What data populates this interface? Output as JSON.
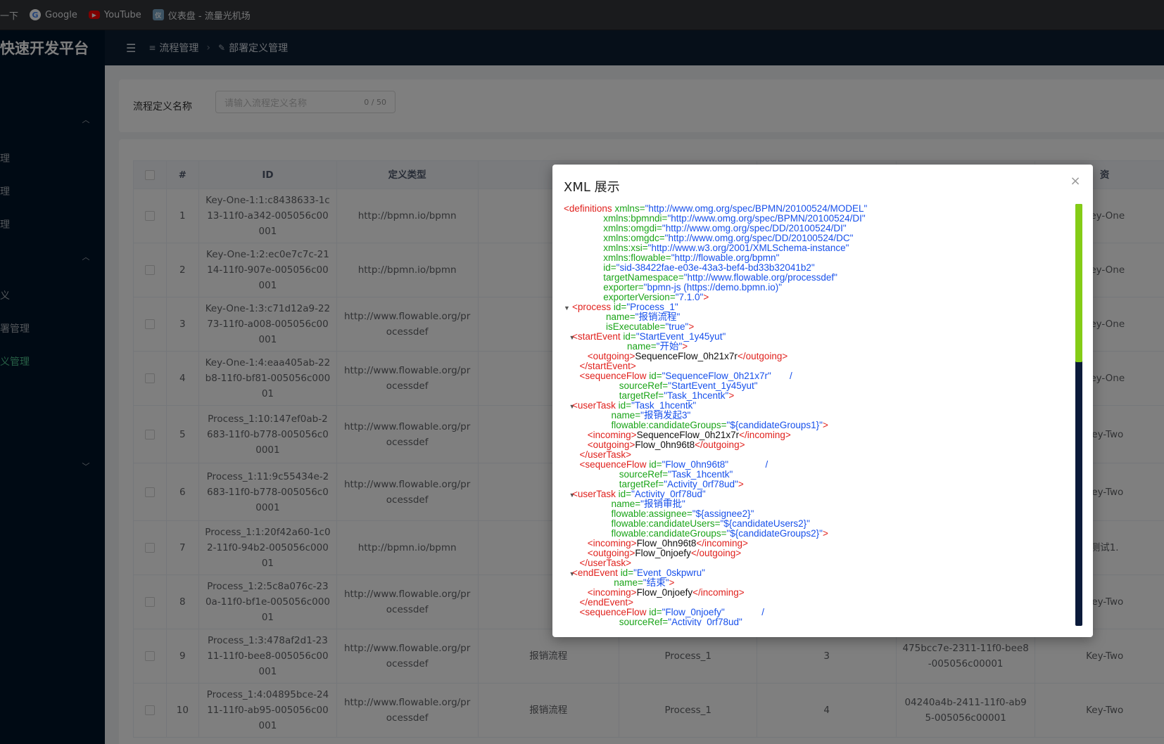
{
  "bookmarks": [
    {
      "icon": "",
      "label": "一下"
    },
    {
      "icon": "G",
      "label": "Google"
    },
    {
      "icon": "▶",
      "label": "YouTube"
    },
    {
      "icon": "仪",
      "label": "仪表盘 - 流量光机场"
    }
  ],
  "sidebar": {
    "logo": "快速开发平台",
    "items": [
      {
        "label": "理",
        "active": false
      },
      {
        "label": "理",
        "active": false
      },
      {
        "label": "理",
        "active": false
      },
      {
        "label": "义",
        "active": false
      },
      {
        "label": "署管理",
        "active": false
      },
      {
        "label": "义管理",
        "active": true
      }
    ]
  },
  "header": {
    "menu_icon": "☰",
    "breadcrumb": [
      {
        "icon": "≡",
        "label": "流程管理"
      },
      {
        "icon": "✎",
        "label": "部署定义管理"
      }
    ]
  },
  "search": {
    "label": "流程定义名称",
    "placeholder": "请输入流程定义名称",
    "count": "0 / 50"
  },
  "table": {
    "columns": [
      "#",
      "ID",
      "定义类型",
      "",
      "",
      "",
      "",
      "资"
    ],
    "rows": [
      {
        "num": "1",
        "id": "Key-One-1:1:c8438633-1c13-11f0-a342-005056c00001",
        "type": "http://bpmn.io/bpmn",
        "name": "",
        "key": "",
        "version": "",
        "deploy": "",
        "res": "Key-One"
      },
      {
        "num": "2",
        "id": "Key-One-1:2:ec0e7c7c-2114-11f0-907e-005056c00001",
        "type": "http://bpmn.io/bpmn",
        "name": "",
        "key": "",
        "version": "",
        "deploy": "",
        "res": "Key-One"
      },
      {
        "num": "3",
        "id": "Key-One-1:3:c71d12a9-2273-11f0-a008-005056c00001",
        "type": "http://www.flowable.org/processdef",
        "name": "",
        "key": "",
        "version": "",
        "deploy": "",
        "res": "Key-One"
      },
      {
        "num": "4",
        "id": "Key-One-1:4:eaa405ab-22b8-11f0-bf81-005056c00001",
        "type": "http://www.flowable.org/processdef",
        "name": "",
        "key": "",
        "version": "",
        "deploy": "",
        "res": "Key-One"
      },
      {
        "num": "5",
        "id": "Process_1:10:147ef0ab-2683-11f0-b778-005056c00001",
        "type": "http://www.flowable.org/processdef",
        "name": "",
        "key": "",
        "version": "",
        "deploy": "",
        "res": "Key-Two"
      },
      {
        "num": "6",
        "id": "Process_1:11:9c55434e-2683-11f0-b778-005056c00001",
        "type": "http://www.flowable.org/processdef",
        "name": "",
        "key": "",
        "version": "",
        "deploy": "",
        "res": "Key-Two"
      },
      {
        "num": "7",
        "id": "Process_1:1:20f42a60-1c02-11f0-94b2-005056c00001",
        "type": "http://bpmn.io/bpmn",
        "name": "",
        "key": "",
        "version": "",
        "deploy": "",
        "res": "测试1."
      },
      {
        "num": "8",
        "id": "Process_1:2:5c8a076c-230a-11f0-bf1e-005056c00001",
        "type": "http://www.flowable.org/processdef",
        "name": "",
        "key": "",
        "version": "",
        "deploy": "",
        "res": "Key-Two"
      },
      {
        "num": "9",
        "id": "Process_1:3:478af2d1-2311-11f0-bee8-005056c00001",
        "type": "http://www.flowable.org/processdef",
        "name": "报销流程",
        "key": "Process_1",
        "version": "3",
        "deploy": "475bcc7e-2311-11f0-bee8-005056c00001",
        "res": "Key-Two"
      },
      {
        "num": "10",
        "id": "Process_1:4:04895bce-2411-11f0-ab95-005056c00001",
        "type": "http://www.flowable.org/processdef",
        "name": "报销流程",
        "key": "Process_1",
        "version": "4",
        "deploy": "04240a4b-2411-11f0-ab95-005056c00001",
        "res": "Key-Two"
      }
    ]
  },
  "modal": {
    "title": "XML 展示",
    "close_icon": "×",
    "xml_lines": [
      [
        [
          "tg",
          "<definitions "
        ],
        [
          "at",
          "xmlns="
        ],
        [
          "vl",
          "\"http://www.omg.org/spec/BPMN/20100524/MODEL\""
        ]
      ],
      [
        [
          "at",
          "               xmlns:bpmndi="
        ],
        [
          "vl",
          "\"http://www.omg.org/spec/BPMN/20100524/DI\""
        ]
      ],
      [
        [
          "at",
          "               xmlns:omgdi="
        ],
        [
          "vl",
          "\"http://www.omg.org/spec/DD/20100524/DI\""
        ]
      ],
      [
        [
          "at",
          "               xmlns:omgdc="
        ],
        [
          "vl",
          "\"http://www.omg.org/spec/DD/20100524/DC\""
        ]
      ],
      [
        [
          "at",
          "               xmlns:xsi="
        ],
        [
          "vl",
          "\"http://www.w3.org/2001/XMLSchema-instance\""
        ]
      ],
      [
        [
          "at",
          "               xmlns:flowable="
        ],
        [
          "vl",
          "\"http://flowable.org/bpmn\""
        ]
      ],
      [
        [
          "at",
          "               id="
        ],
        [
          "vl",
          "\"sid-38422fae-e03e-43a3-bef4-bd33b32041b2\""
        ]
      ],
      [
        [
          "at",
          "               targetNamespace="
        ],
        [
          "vl",
          "\"http://www.flowable.org/processdef\""
        ]
      ],
      [
        [
          "at",
          "               exporter="
        ],
        [
          "vl",
          "\"bpmn-js (https://demo.bpmn.io)\""
        ]
      ],
      [
        [
          "at",
          "               exporterVersion="
        ],
        [
          "vl",
          "\"7.1.0\""
        ],
        [
          "tg",
          ">"
        ]
      ],
      [
        [
          "tog",
          "▼"
        ],
        [
          "tg",
          "<process "
        ],
        [
          "at",
          "id="
        ],
        [
          "vl",
          "\"Process_1\""
        ]
      ],
      [
        [
          "at",
          "                name="
        ],
        [
          "vl",
          "\"报销流程\""
        ]
      ],
      [
        [
          "at",
          "                isExecutable="
        ],
        [
          "vl",
          "\"true\""
        ],
        [
          "tg",
          ">"
        ]
      ],
      [
        [
          "tog",
          "   ▼"
        ],
        [
          "tg",
          "<startEvent "
        ],
        [
          "at",
          "id="
        ],
        [
          "vl",
          "\"StartEvent_1y45yut\""
        ]
      ],
      [
        [
          "at",
          "                        name="
        ],
        [
          "vl",
          "\"开始\""
        ],
        [
          "tg",
          ">"
        ]
      ],
      [
        [
          "tg",
          "         <outgoing>"
        ],
        [
          "tx",
          "SequenceFlow_0h21x7r"
        ],
        [
          "tg",
          "</outgoing>"
        ]
      ],
      [
        [
          "tg",
          "      </startEvent>"
        ]
      ],
      [
        [
          "tg",
          "      <sequenceFlow "
        ],
        [
          "at",
          "id="
        ],
        [
          "vl",
          "\"SequenceFlow_0h21x7r\""
        ],
        [
          "vl",
          "       /"
        ]
      ],
      [
        [
          "at",
          "                     sourceRef="
        ],
        [
          "vl",
          "\"StartEvent_1y45yut\""
        ]
      ],
      [
        [
          "at",
          "                     targetRef="
        ],
        [
          "vl",
          "\"Task_1hcentk\""
        ],
        [
          "tg",
          ">"
        ]
      ],
      [
        [
          "tog",
          "   ▼"
        ],
        [
          "tg",
          "<userTask "
        ],
        [
          "at",
          "id="
        ],
        [
          "vl",
          "\"Task_1hcentk\""
        ]
      ],
      [
        [
          "at",
          "                  name="
        ],
        [
          "vl",
          "\"报销发起3\""
        ]
      ],
      [
        [
          "at",
          "                  flowable:candidateGroups="
        ],
        [
          "vl",
          "\"${candidateGroups1}\""
        ],
        [
          "tg",
          ">"
        ]
      ],
      [
        [
          "tg",
          "         <incoming>"
        ],
        [
          "tx",
          "SequenceFlow_0h21x7r"
        ],
        [
          "tg",
          "</incoming>"
        ]
      ],
      [
        [
          "tg",
          "         <outgoing>"
        ],
        [
          "tx",
          "Flow_0hn96t8"
        ],
        [
          "tg",
          "</outgoing>"
        ]
      ],
      [
        [
          "tg",
          "      </userTask>"
        ]
      ],
      [
        [
          "tg",
          "      <sequenceFlow "
        ],
        [
          "at",
          "id="
        ],
        [
          "vl",
          "\"Flow_0hn96t8\""
        ],
        [
          "vl",
          "              /"
        ]
      ],
      [
        [
          "at",
          "                     sourceRef="
        ],
        [
          "vl",
          "\"Task_1hcentk\""
        ]
      ],
      [
        [
          "at",
          "                     targetRef="
        ],
        [
          "vl",
          "\"Activity_0rf78ud\""
        ],
        [
          "tg",
          ">"
        ]
      ],
      [
        [
          "tog",
          "   ▼"
        ],
        [
          "tg",
          "<userTask "
        ],
        [
          "at",
          "id="
        ],
        [
          "vl",
          "\"Activity_0rf78ud\""
        ]
      ],
      [
        [
          "at",
          "                  name="
        ],
        [
          "vl",
          "\"报销审批\""
        ]
      ],
      [
        [
          "at",
          "                  flowable:assignee="
        ],
        [
          "vl",
          "\"${assignee2}\""
        ]
      ],
      [
        [
          "at",
          "                  flowable:candidateUsers="
        ],
        [
          "vl",
          "\"${candidateUsers2}\""
        ]
      ],
      [
        [
          "at",
          "                  flowable:candidateGroups="
        ],
        [
          "vl",
          "\"${candidateGroups2}\""
        ],
        [
          "tg",
          ">"
        ]
      ],
      [
        [
          "tg",
          "         <incoming>"
        ],
        [
          "tx",
          "Flow_0hn96t8"
        ],
        [
          "tg",
          "</incoming>"
        ]
      ],
      [
        [
          "tg",
          "         <outgoing>"
        ],
        [
          "tx",
          "Flow_0njoefy"
        ],
        [
          "tg",
          "</outgoing>"
        ]
      ],
      [
        [
          "tg",
          "      </userTask>"
        ]
      ],
      [
        [
          "tog",
          "   ▼"
        ],
        [
          "tg",
          "<endEvent "
        ],
        [
          "at",
          "id="
        ],
        [
          "vl",
          "\"Event_0skpwru\""
        ]
      ],
      [
        [
          "at",
          "                   name="
        ],
        [
          "vl",
          "\"结束\""
        ],
        [
          "tg",
          ">"
        ]
      ],
      [
        [
          "tg",
          "         <incoming>"
        ],
        [
          "tx",
          "Flow_0njoefy"
        ],
        [
          "tg",
          "</incoming>"
        ]
      ],
      [
        [
          "tg",
          "      </endEvent>"
        ]
      ],
      [
        [
          "tg",
          "      <sequenceFlow "
        ],
        [
          "at",
          "id="
        ],
        [
          "vl",
          "\"Flow_0njoefy\""
        ],
        [
          "vl",
          "              /"
        ]
      ],
      [
        [
          "at",
          "                     sourceRef="
        ],
        [
          "vl",
          "\"Activity_0rf78ud\""
        ]
      ]
    ]
  },
  "colors": {
    "sidebar_bg": "#001529",
    "header_bg": "#0c1e33",
    "active_menu": "#4fc08d",
    "xml_tag": "#e0211d",
    "xml_attr": "#1aa418",
    "xml_value": "#1750eb",
    "scroll_thumb": "#84cc16"
  }
}
